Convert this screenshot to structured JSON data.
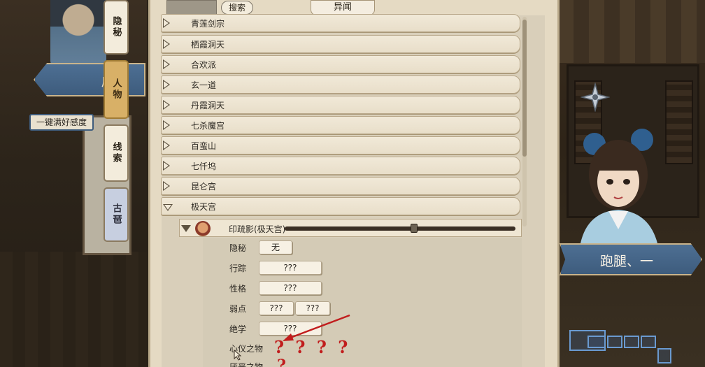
{
  "side_tabs": [
    {
      "label": "隐秘"
    },
    {
      "label": "人物"
    },
    {
      "label": "线索"
    },
    {
      "label": "古琶"
    }
  ],
  "left": {
    "ribbon_text": "屠",
    "love_button": "一键满好感度"
  },
  "header": {
    "search_label": "搜索",
    "title": "异闻"
  },
  "factions": [
    {
      "name": "青莲剑宗"
    },
    {
      "name": "栖霞洞天"
    },
    {
      "name": "合欢派"
    },
    {
      "name": "玄一道"
    },
    {
      "name": "丹霞洞天"
    },
    {
      "name": "七杀魔宫"
    },
    {
      "name": "百蛮山"
    },
    {
      "name": "七仟坞"
    },
    {
      "name": "昆仑宫"
    },
    {
      "name": "极天宫"
    }
  ],
  "character": {
    "name": "印疏影(极天宫)"
  },
  "details": {
    "secret": {
      "label": "隐秘",
      "value": "无"
    },
    "trace": {
      "label": "行踪",
      "value": "???"
    },
    "personality": {
      "label": "性格",
      "value": "???"
    },
    "weakness": {
      "label": "弱点",
      "value1": "???",
      "value2": "???"
    },
    "skill": {
      "label": "绝学",
      "value": "???"
    },
    "beloved_item": {
      "label": "心仪之物"
    },
    "hated_item": {
      "label": "厌恶之物"
    }
  },
  "annotation": {
    "qmarks": "? ? ? ?",
    "qmark_single": "?"
  },
  "right": {
    "name_banner": "跑腿、一"
  },
  "colors": {
    "accent_blue": "#3e5c7d",
    "parchment": "#e5dac3",
    "annotation_red": "#c11d1d"
  }
}
